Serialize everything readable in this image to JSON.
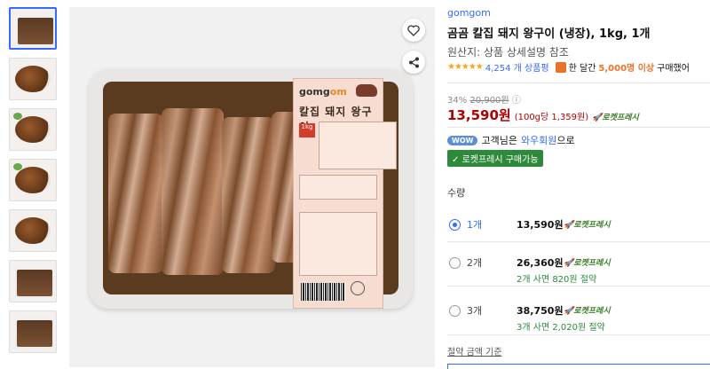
{
  "thumbnails": [
    {
      "kind": "tray",
      "active": true
    },
    {
      "kind": "dish"
    },
    {
      "kind": "dish"
    },
    {
      "kind": "dish"
    },
    {
      "kind": "dish"
    },
    {
      "kind": "tray"
    },
    {
      "kind": "tray"
    },
    {
      "kind": "dish"
    }
  ],
  "package_label": {
    "brand_prefix": "gomg",
    "brand_suffix": "om",
    "title": "칼집 돼지 왕구이",
    "kg_badge": "1kg"
  },
  "actions": {
    "heart_icon": "heart-icon",
    "share_icon": "share-icon"
  },
  "product": {
    "brand": "gomgom",
    "title": "곰곰 칼집 돼지 왕구이 (냉장), 1kg, 1개",
    "origin": "원산지: 상품 상세설명 참조",
    "stars": "★★★★★",
    "review_count": "4,254 개 상품평",
    "month_text_prefix": "한 달간",
    "month_count": "5,000명 이상",
    "month_text_suffix": "구매했어"
  },
  "pricing": {
    "discount": "34%",
    "original_price": "20,900원",
    "info_icon": "ⓘ",
    "price": "13,590원",
    "unit_price": "(100g당 1,359원)",
    "rocket_fresh": "로켓프레시"
  },
  "wow": {
    "badge": "WOW",
    "text_prefix": "고객님은",
    "member_link": "와우회원",
    "text_suffix": "으로",
    "rocket_badge": "✓ 로켓프레시 구매가능"
  },
  "quantity": {
    "label": "수량",
    "options": [
      {
        "qty": "1개",
        "price": "13,590원",
        "rocket": "로켓프레시",
        "save": "",
        "selected": true
      },
      {
        "qty": "2개",
        "price": "26,360원",
        "rocket": "로켓프레시",
        "save": "2개 사면 820원 절약",
        "selected": false
      },
      {
        "qty": "3개",
        "price": "38,750원",
        "rocket": "로켓프레시",
        "save": "3개 사면 2,020원 절약",
        "selected": false
      }
    ],
    "footer_link": "절약 금액 기준"
  },
  "colors": {
    "accent": "#346aff",
    "price_red": "#ae0000",
    "green": "#2c8a3a",
    "star": "#f5a623"
  }
}
